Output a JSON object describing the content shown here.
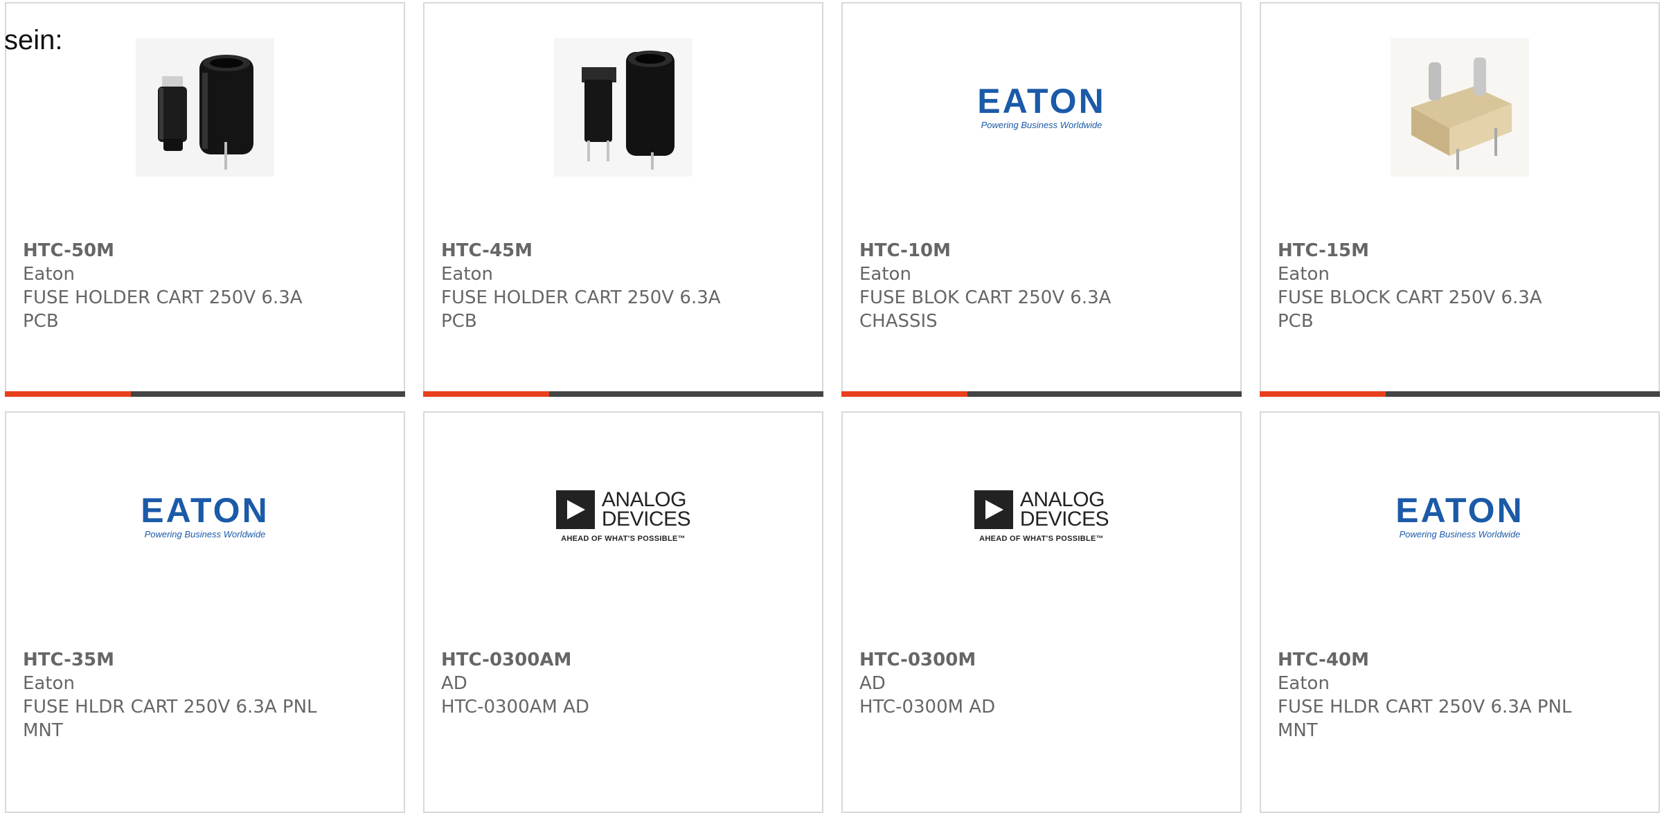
{
  "intro_text": "sein:",
  "accent_color": "#e8401c",
  "bar_color": "#444444",
  "logos": {
    "eaton": {
      "word": "EATON",
      "tagline": "Powering Business Worldwide"
    },
    "analog_devices": {
      "line1": "ANALOG",
      "line2": "DEVICES",
      "tagline": "AHEAD OF WHAT'S POSSIBLE™"
    }
  },
  "products": [
    {
      "part": "HTC-50M",
      "maker": "Eaton",
      "desc_line1": "FUSE HOLDER CART 250V 6.3A",
      "desc_line2": "PCB",
      "image": "black-fuse-holder-photo"
    },
    {
      "part": "HTC-45M",
      "maker": "Eaton",
      "desc_line1": "FUSE HOLDER CART 250V 6.3A",
      "desc_line2": "PCB",
      "image": "black-fuse-holder-photo"
    },
    {
      "part": "HTC-10M",
      "maker": "Eaton",
      "desc_line1": "FUSE BLOK CART 250V 6.3A",
      "desc_line2": "CHASSIS",
      "image": "eaton-logo"
    },
    {
      "part": "HTC-15M",
      "maker": "Eaton",
      "desc_line1": "FUSE BLOCK CART 250V 6.3A",
      "desc_line2": "PCB",
      "image": "beige-fuse-block-photo"
    },
    {
      "part": "HTC-35M",
      "maker": "Eaton",
      "desc_line1": "FUSE HLDR CART 250V 6.3A PNL",
      "desc_line2": "MNT",
      "image": "eaton-logo"
    },
    {
      "part": "HTC-0300AM",
      "maker": "AD",
      "desc_line1": "HTC-0300AM AD",
      "desc_line2": "",
      "image": "analog-devices-logo"
    },
    {
      "part": "HTC-0300M",
      "maker": "AD",
      "desc_line1": "HTC-0300M AD",
      "desc_line2": "",
      "image": "analog-devices-logo"
    },
    {
      "part": "HTC-40M",
      "maker": "Eaton",
      "desc_line1": "FUSE HLDR CART 250V 6.3A PNL",
      "desc_line2": "MNT",
      "image": "eaton-logo"
    }
  ]
}
